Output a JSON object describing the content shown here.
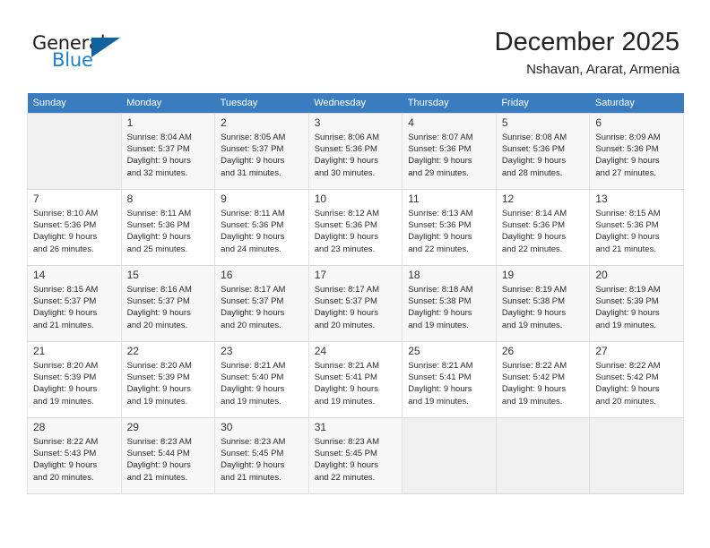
{
  "brand": {
    "name_top": "General",
    "name_bottom": "Blue",
    "triangle_icon": "triangle-logo-icon",
    "color_dark": "#1b1b1b",
    "color_blue": "#1f7fc4",
    "triangle_color": "#11619e"
  },
  "header": {
    "month_title": "December 2025",
    "location": "Nshavan, Ararat, Armenia",
    "header_bg": "#3a7cc0"
  },
  "calendar": {
    "weekday_headers": [
      "Sunday",
      "Monday",
      "Tuesday",
      "Wednesday",
      "Thursday",
      "Friday",
      "Saturday"
    ],
    "weeks": [
      [
        {
          "day": "",
          "info": ""
        },
        {
          "day": "1",
          "info": "Sunrise: 8:04 AM\nSunset: 5:37 PM\nDaylight: 9 hours\nand 32 minutes."
        },
        {
          "day": "2",
          "info": "Sunrise: 8:05 AM\nSunset: 5:37 PM\nDaylight: 9 hours\nand 31 minutes."
        },
        {
          "day": "3",
          "info": "Sunrise: 8:06 AM\nSunset: 5:36 PM\nDaylight: 9 hours\nand 30 minutes."
        },
        {
          "day": "4",
          "info": "Sunrise: 8:07 AM\nSunset: 5:36 PM\nDaylight: 9 hours\nand 29 minutes."
        },
        {
          "day": "5",
          "info": "Sunrise: 8:08 AM\nSunset: 5:36 PM\nDaylight: 9 hours\nand 28 minutes."
        },
        {
          "day": "6",
          "info": "Sunrise: 8:09 AM\nSunset: 5:36 PM\nDaylight: 9 hours\nand 27 minutes."
        }
      ],
      [
        {
          "day": "7",
          "info": "Sunrise: 8:10 AM\nSunset: 5:36 PM\nDaylight: 9 hours\nand 26 minutes."
        },
        {
          "day": "8",
          "info": "Sunrise: 8:11 AM\nSunset: 5:36 PM\nDaylight: 9 hours\nand 25 minutes."
        },
        {
          "day": "9",
          "info": "Sunrise: 8:11 AM\nSunset: 5:36 PM\nDaylight: 9 hours\nand 24 minutes."
        },
        {
          "day": "10",
          "info": "Sunrise: 8:12 AM\nSunset: 5:36 PM\nDaylight: 9 hours\nand 23 minutes."
        },
        {
          "day": "11",
          "info": "Sunrise: 8:13 AM\nSunset: 5:36 PM\nDaylight: 9 hours\nand 22 minutes."
        },
        {
          "day": "12",
          "info": "Sunrise: 8:14 AM\nSunset: 5:36 PM\nDaylight: 9 hours\nand 22 minutes."
        },
        {
          "day": "13",
          "info": "Sunrise: 8:15 AM\nSunset: 5:36 PM\nDaylight: 9 hours\nand 21 minutes."
        }
      ],
      [
        {
          "day": "14",
          "info": "Sunrise: 8:15 AM\nSunset: 5:37 PM\nDaylight: 9 hours\nand 21 minutes."
        },
        {
          "day": "15",
          "info": "Sunrise: 8:16 AM\nSunset: 5:37 PM\nDaylight: 9 hours\nand 20 minutes."
        },
        {
          "day": "16",
          "info": "Sunrise: 8:17 AM\nSunset: 5:37 PM\nDaylight: 9 hours\nand 20 minutes."
        },
        {
          "day": "17",
          "info": "Sunrise: 8:17 AM\nSunset: 5:37 PM\nDaylight: 9 hours\nand 20 minutes."
        },
        {
          "day": "18",
          "info": "Sunrise: 8:18 AM\nSunset: 5:38 PM\nDaylight: 9 hours\nand 19 minutes."
        },
        {
          "day": "19",
          "info": "Sunrise: 8:19 AM\nSunset: 5:38 PM\nDaylight: 9 hours\nand 19 minutes."
        },
        {
          "day": "20",
          "info": "Sunrise: 8:19 AM\nSunset: 5:39 PM\nDaylight: 9 hours\nand 19 minutes."
        }
      ],
      [
        {
          "day": "21",
          "info": "Sunrise: 8:20 AM\nSunset: 5:39 PM\nDaylight: 9 hours\nand 19 minutes."
        },
        {
          "day": "22",
          "info": "Sunrise: 8:20 AM\nSunset: 5:39 PM\nDaylight: 9 hours\nand 19 minutes."
        },
        {
          "day": "23",
          "info": "Sunrise: 8:21 AM\nSunset: 5:40 PM\nDaylight: 9 hours\nand 19 minutes."
        },
        {
          "day": "24",
          "info": "Sunrise: 8:21 AM\nSunset: 5:41 PM\nDaylight: 9 hours\nand 19 minutes."
        },
        {
          "day": "25",
          "info": "Sunrise: 8:21 AM\nSunset: 5:41 PM\nDaylight: 9 hours\nand 19 minutes."
        },
        {
          "day": "26",
          "info": "Sunrise: 8:22 AM\nSunset: 5:42 PM\nDaylight: 9 hours\nand 19 minutes."
        },
        {
          "day": "27",
          "info": "Sunrise: 8:22 AM\nSunset: 5:42 PM\nDaylight: 9 hours\nand 20 minutes."
        }
      ],
      [
        {
          "day": "28",
          "info": "Sunrise: 8:22 AM\nSunset: 5:43 PM\nDaylight: 9 hours\nand 20 minutes."
        },
        {
          "day": "29",
          "info": "Sunrise: 8:23 AM\nSunset: 5:44 PM\nDaylight: 9 hours\nand 21 minutes."
        },
        {
          "day": "30",
          "info": "Sunrise: 8:23 AM\nSunset: 5:45 PM\nDaylight: 9 hours\nand 21 minutes."
        },
        {
          "day": "31",
          "info": "Sunrise: 8:23 AM\nSunset: 5:45 PM\nDaylight: 9 hours\nand 22 minutes."
        },
        {
          "day": "",
          "info": ""
        },
        {
          "day": "",
          "info": ""
        },
        {
          "day": "",
          "info": ""
        }
      ]
    ]
  }
}
